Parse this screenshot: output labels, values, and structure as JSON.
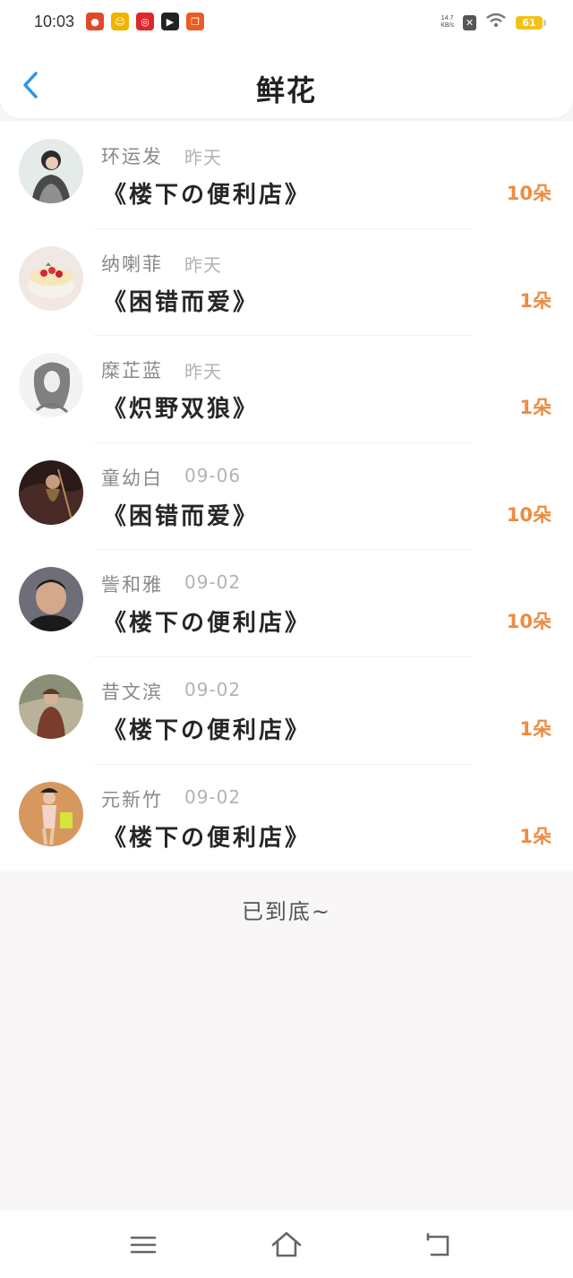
{
  "status_bar": {
    "time": "10:03",
    "apps": [
      {
        "icon": "app-icon-1",
        "color": "#e04a2b"
      },
      {
        "icon": "app-icon-2",
        "color": "#f0b400"
      },
      {
        "icon": "netease-music-icon",
        "color": "#e0262b"
      },
      {
        "icon": "video-icon",
        "color": "#222222"
      },
      {
        "icon": "app-icon-5",
        "color": "#ee5a24"
      }
    ],
    "net_speed_value": "14.7",
    "net_speed_unit": "KB/s",
    "battery": "61"
  },
  "header": {
    "title": "鲜花",
    "back_icon": "back-arrow-icon"
  },
  "colors": {
    "accent_blue": "#2f95e0",
    "count_orange": "#ee8b41"
  },
  "items": [
    {
      "name": "环运发",
      "date": "昨天",
      "book": "《楼下の便利店》",
      "count": "10朵"
    },
    {
      "name": "纳喇菲",
      "date": "昨天",
      "book": "《困错而爱》",
      "count": "1朵"
    },
    {
      "name": "糜芷蓝",
      "date": "昨天",
      "book": "《炽野双狼》",
      "count": "1朵"
    },
    {
      "name": "童幼白",
      "date": "09-06",
      "book": "《困错而爱》",
      "count": "10朵"
    },
    {
      "name": "訾和雅",
      "date": "09-02",
      "book": "《楼下の便利店》",
      "count": "10朵"
    },
    {
      "name": "昔文滨",
      "date": "09-02",
      "book": "《楼下の便利店》",
      "count": "1朵"
    },
    {
      "name": "元新竹",
      "date": "09-02",
      "book": "《楼下の便利店》",
      "count": "1朵"
    }
  ],
  "footer_text": "已到底~",
  "nav": {
    "menu_icon": "menu-icon",
    "home_icon": "home-icon",
    "back_icon": "back-icon"
  }
}
